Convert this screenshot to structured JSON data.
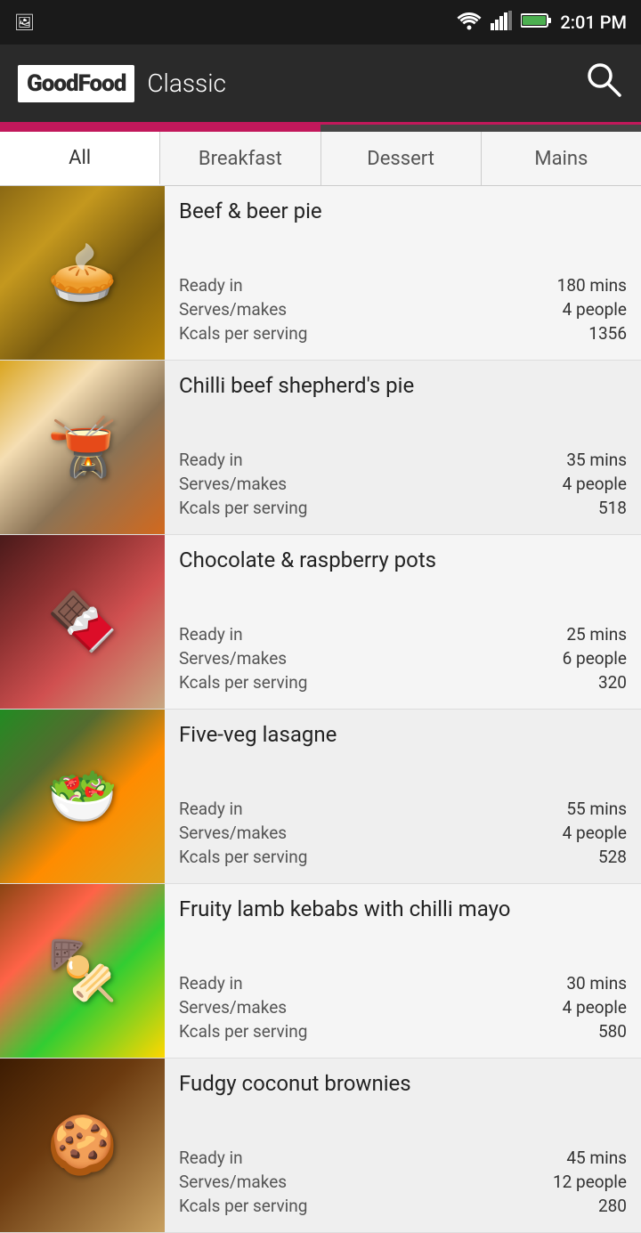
{
  "statusBar": {
    "time": "2:01 PM"
  },
  "header": {
    "logoText": "GoodFood",
    "title": "Classic",
    "searchAriaLabel": "Search"
  },
  "tabs": [
    {
      "id": "all",
      "label": "All",
      "active": true
    },
    {
      "id": "breakfast",
      "label": "Breakfast",
      "active": false
    },
    {
      "id": "dessert",
      "label": "Dessert",
      "active": false
    },
    {
      "id": "mains",
      "label": "Mains",
      "active": false
    }
  ],
  "recipes": [
    {
      "name": "Beef & beer pie",
      "readyIn": "180 mins",
      "serves": "4 people",
      "kcals": "1356",
      "foodClass": "food-beef",
      "emoji": "🥧"
    },
    {
      "name": "Chilli beef shepherd's pie",
      "readyIn": "35 mins",
      "serves": "4 people",
      "kcals": "518",
      "foodClass": "food-chilli",
      "emoji": "🫕"
    },
    {
      "name": "Chocolate & raspberry pots",
      "readyIn": "25 mins",
      "serves": "6 people",
      "kcals": "320",
      "foodClass": "food-choc",
      "emoji": "🍫"
    },
    {
      "name": "Five-veg lasagne",
      "readyIn": "55 mins",
      "serves": "4 people",
      "kcals": "528",
      "foodClass": "food-lasagne",
      "emoji": "🥗"
    },
    {
      "name": "Fruity lamb kebabs with chilli mayo",
      "readyIn": "30 mins",
      "serves": "4 people",
      "kcals": "580",
      "foodClass": "food-kebab",
      "emoji": "🍢"
    },
    {
      "name": "Fudgy coconut brownies",
      "readyIn": "45 mins",
      "serves": "12 people",
      "kcals": "280",
      "foodClass": "food-brownie",
      "emoji": "🍪"
    }
  ],
  "labels": {
    "readyIn": "Ready in",
    "serves": "Serves/makes",
    "kcals": "Kcals per serving"
  }
}
